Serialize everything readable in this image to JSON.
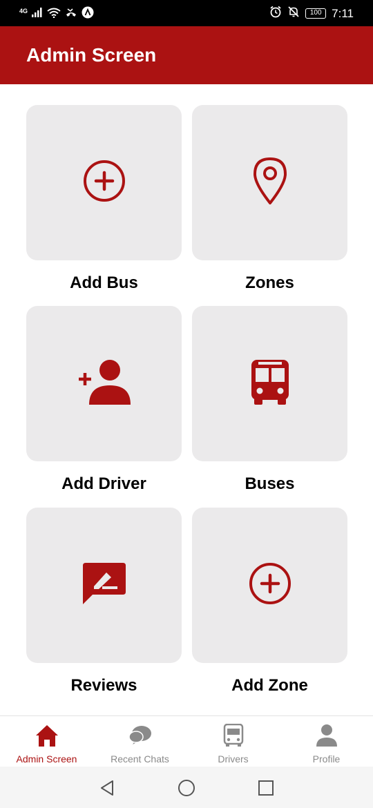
{
  "status_bar": {
    "network": "4G",
    "time": "7:11",
    "battery": "100"
  },
  "app_bar": {
    "title": "Admin Screen"
  },
  "tiles": [
    {
      "label": "Add Bus",
      "icon": "add-circle-icon"
    },
    {
      "label": "Zones",
      "icon": "location-pin-icon"
    },
    {
      "label": "Add Driver",
      "icon": "add-person-icon"
    },
    {
      "label": "Buses",
      "icon": "bus-icon"
    },
    {
      "label": "Reviews",
      "icon": "review-icon"
    },
    {
      "label": "Add Zone",
      "icon": "add-circle-icon"
    }
  ],
  "bottom_nav": {
    "items": [
      {
        "label": "Admin Screen",
        "icon": "home-icon",
        "active": true
      },
      {
        "label": "Recent Chats",
        "icon": "chat-icon",
        "active": false
      },
      {
        "label": "Drivers",
        "icon": "bus-icon",
        "active": false
      },
      {
        "label": "Profile",
        "icon": "person-icon",
        "active": false
      }
    ]
  },
  "colors": {
    "primary": "#ab1212",
    "tile_background": "#ebeaeb",
    "inactive_nav": "#8a8a8a"
  }
}
